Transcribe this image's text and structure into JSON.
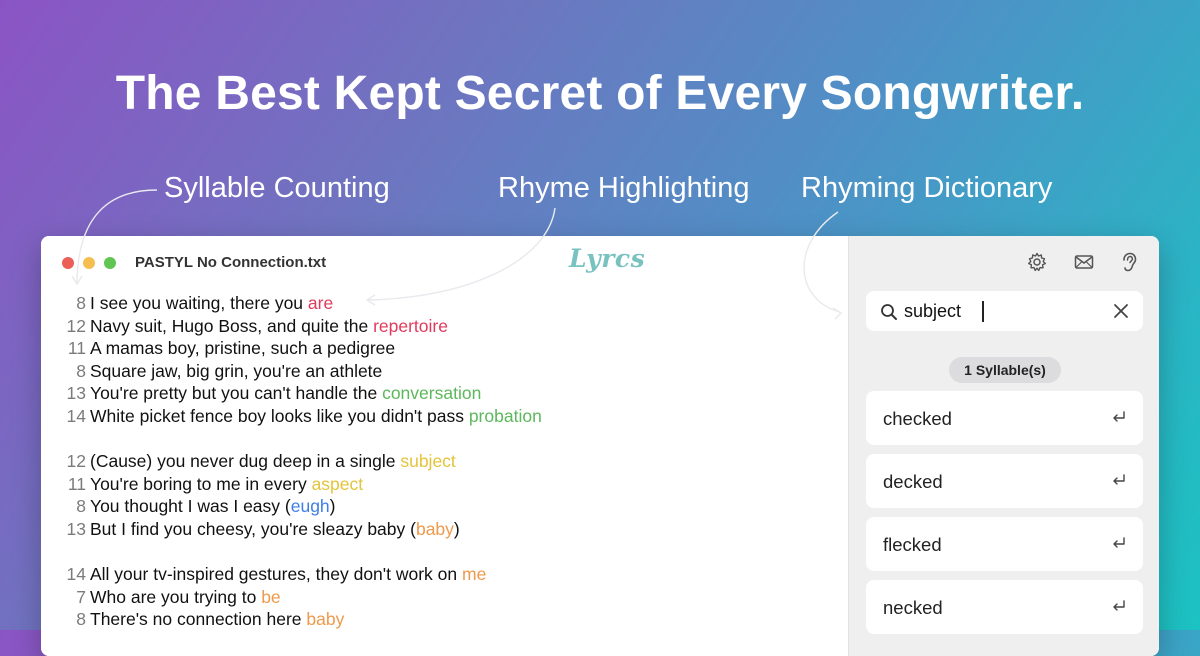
{
  "headline": "The Best Kept Secret of Every Songwriter.",
  "features": {
    "syllable": "Syllable Counting",
    "rhyme": "Rhyme Highlighting",
    "dictionary": "Rhyming Dictionary"
  },
  "window": {
    "filename": "PASTYL No Connection.txt",
    "logo": "Lyrcs"
  },
  "lyrics": [
    {
      "count": "8",
      "text": "I see you waiting, there you ",
      "rhyme": "are",
      "color": "#e03a5c"
    },
    {
      "count": "12",
      "text": "Navy suit, Hugo Boss, and quite the ",
      "rhyme": "repertoire",
      "color": "#e03a5c"
    },
    {
      "count": "11",
      "text": "A mamas boy, pristine, such a pedigree",
      "rhyme": "",
      "color": ""
    },
    {
      "count": "8",
      "text": "Square jaw, big grin, you're an athlete",
      "rhyme": "",
      "color": ""
    },
    {
      "count": "13",
      "text": "You're pretty but you can't handle the ",
      "rhyme": "conversation",
      "color": "#5cb85c"
    },
    {
      "count": "14",
      "text": "White picket fence boy looks like you didn't pass ",
      "rhyme": "probation",
      "color": "#5cb85c"
    },
    null,
    {
      "count": "12",
      "text": "(Cause) you never dug deep in a single ",
      "rhyme": "subject",
      "color": "#e4c43a"
    },
    {
      "count": "11",
      "text": "You're boring to me in every ",
      "rhyme": "aspect",
      "color": "#e4c43a"
    },
    {
      "count": "8",
      "text": "You thought I was I easy (",
      "rhyme": "eugh",
      "color": "#3f7ee6",
      "after": ")"
    },
    {
      "count": "13",
      "text": "But I find you cheesy, you're sleazy baby (",
      "rhyme": "baby",
      "color": "#ef9a4b",
      "after": ")"
    },
    null,
    {
      "count": "14",
      "text": "All your tv-inspired gestures, they don't work on ",
      "rhyme": "me",
      "color": "#ef9a4b"
    },
    {
      "count": "7",
      "text": "Who are you trying to ",
      "rhyme": "be",
      "color": "#ef9a4b"
    },
    {
      "count": "8",
      "text": "There's no connection here ",
      "rhyme": "baby",
      "color": "#ef9a4b"
    }
  ],
  "sidebar": {
    "search_value": "subject",
    "badge": "1 Syllable(s)",
    "results": [
      "checked",
      "decked",
      "flecked",
      "necked"
    ]
  },
  "icons": {
    "toolbar": [
      "gear-icon",
      "mail-icon",
      "ear-icon"
    ],
    "search": "search-icon",
    "clear": "close-icon",
    "result_action": "return-icon"
  },
  "colors": {
    "red_rhyme": "#e03a5c",
    "green_rhyme": "#5cb85c",
    "yellow_rhyme": "#e4c43a",
    "blue_rhyme": "#3f7ee6",
    "orange_rhyme": "#ef9a4b"
  }
}
